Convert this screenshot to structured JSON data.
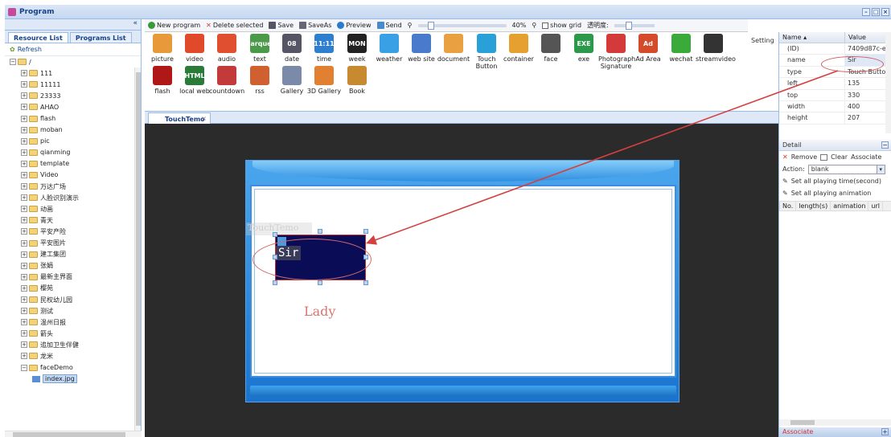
{
  "window": {
    "title": "Program",
    "controls": [
      "–",
      "□",
      "×"
    ]
  },
  "left_panel": {
    "collapse": "«",
    "tabs": [
      "Resource List",
      "Programs List"
    ],
    "refresh": "Refresh",
    "root": "/",
    "folders": [
      "111",
      "11111",
      "23333",
      "AHAO",
      "flash",
      "moban",
      "pic",
      "qianming",
      "template",
      "Video",
      "万达广场",
      "人脸识别演示",
      "动画",
      "青天",
      "平安产险",
      "平安图片",
      "建工集团",
      "张娟",
      "最新主界面",
      "樱苑",
      "民权幼儿园",
      "测试",
      "温州日报",
      "箭头",
      "追加卫生伴健",
      "龙米",
      "faceDemo"
    ],
    "selected_file": "index.jpg"
  },
  "toolbar": {
    "new_program": "New program",
    "delete_selected": "Delete selected",
    "save": "Save",
    "save_as": "SaveAs",
    "preview": "Preview",
    "send": "Send",
    "zoom": "40%",
    "show_grid": "show grid",
    "opacity_label": "透明度:"
  },
  "widgets": [
    {
      "label": "picture",
      "icon": "picture-icon",
      "color": "#e89a3a"
    },
    {
      "label": "video",
      "icon": "video-icon",
      "color": "#e04a2a"
    },
    {
      "label": "audio",
      "icon": "audio-icon",
      "color": "#e05030"
    },
    {
      "label": "text",
      "icon": "text-icon",
      "color": "#4a9a4a"
    },
    {
      "label": "date",
      "icon": "date-icon",
      "color": "#556"
    },
    {
      "label": "time",
      "icon": "time-icon",
      "color": "#2e7fcf"
    },
    {
      "label": "week",
      "icon": "week-icon",
      "color": "#222"
    },
    {
      "label": "weather",
      "icon": "weather-icon",
      "color": "#3aa0e6"
    },
    {
      "label": "web site",
      "icon": "globe-icon",
      "color": "#4a7acc"
    },
    {
      "label": "document",
      "icon": "document-icon",
      "color": "#e8a040"
    },
    {
      "label": "Touch Button",
      "icon": "touch-icon",
      "color": "#2aa0d8"
    },
    {
      "label": "container",
      "icon": "container-icon",
      "color": "#e6a030"
    },
    {
      "label": "face",
      "icon": "face-icon",
      "color": "#555"
    },
    {
      "label": "exe",
      "icon": "exe-icon",
      "color": "#2a9a4a"
    },
    {
      "label": "Photograph Signature",
      "icon": "camera-icon",
      "color": "#d43a3a"
    },
    {
      "label": "Ad Area",
      "icon": "ad-icon",
      "color": "#d44a2a"
    },
    {
      "label": "wechat",
      "icon": "wechat-icon",
      "color": "#3aaa3a"
    },
    {
      "label": "streamvideo",
      "icon": "clapper-icon",
      "color": "#333"
    },
    {
      "label": "flash",
      "icon": "flash-icon",
      "color": "#b01818"
    },
    {
      "label": "local web",
      "icon": "html-icon",
      "color": "#2a7a3a"
    },
    {
      "label": "countdown",
      "icon": "hourglass-icon",
      "color": "#c23a3a"
    },
    {
      "label": "rss",
      "icon": "rss-icon",
      "color": "#d06030"
    },
    {
      "label": "Gallery",
      "icon": "gallery-icon",
      "color": "#7a8aa8"
    },
    {
      "label": "3D Gallery",
      "icon": "gallery3d-icon",
      "color": "#e08030"
    },
    {
      "label": "Book",
      "icon": "book-icon",
      "color": "#c88a30"
    }
  ],
  "widget_glyphs": {
    "date": "08",
    "time": "11:11",
    "week": "MON",
    "text": "marquee",
    "local web": "HTML",
    "exe": "EXE",
    "Ad Area": "Ad"
  },
  "setting_label": "Setting",
  "editor": {
    "tab": "TouchTemo",
    "overlay_label": "TouchTemo",
    "button_text": "Sir",
    "lady_text": "Lady"
  },
  "properties": {
    "col_name": "Name",
    "col_value": "Value",
    "rows": [
      {
        "k": "(ID)",
        "v": "7409d87c-e..."
      },
      {
        "k": "name",
        "v": "Sir"
      },
      {
        "k": "type",
        "v": "Touch Button"
      },
      {
        "k": "left",
        "v": "135"
      },
      {
        "k": "top",
        "v": "330"
      },
      {
        "k": "width",
        "v": "400"
      },
      {
        "k": "height",
        "v": "207"
      }
    ]
  },
  "detail": {
    "title": "Detail",
    "remove": "Remove",
    "clear": "Clear",
    "associate": "Associate",
    "action_label": "Action:",
    "action_value": "blank",
    "set_time": "Set all playing time(second)",
    "set_anim": "Set all playing animation",
    "cols": [
      "No.",
      "length(s)",
      "animation",
      "url"
    ],
    "bottom_bar": "Associate"
  },
  "colors": {
    "accent": "#15428b",
    "annotation": "#d44040"
  }
}
